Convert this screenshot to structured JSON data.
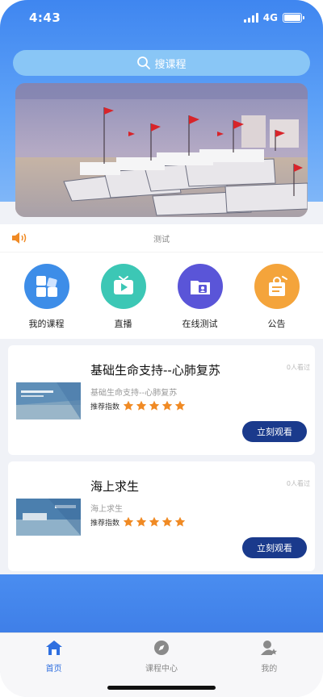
{
  "status_bar": {
    "time": "4:43",
    "network": "4G",
    "battery_level": 1.0
  },
  "search": {
    "placeholder": "搜课程"
  },
  "notice": {
    "text": "测试"
  },
  "menu": {
    "items": [
      {
        "label": "我的课程",
        "color": "#3d8de8",
        "icon": "course-icon"
      },
      {
        "label": "直播",
        "color": "#3cc7b5",
        "icon": "live-icon"
      },
      {
        "label": "在线测试",
        "color": "#5a55d8",
        "icon": "test-folder-icon"
      },
      {
        "label": "公告",
        "color": "#f4a43b",
        "icon": "announcement-icon"
      }
    ]
  },
  "courses": [
    {
      "title": "基础生命支持--心肺复苏",
      "subtitle": "基础生命支持--心肺复苏",
      "rating_label": "推荐指数",
      "rating": 5,
      "count": "0人看过",
      "button": "立刻观看"
    },
    {
      "title": "海上求生",
      "subtitle": "海上求生",
      "rating_label": "推荐指数",
      "rating": 5,
      "count": "0人看过",
      "button": "立刻观看"
    }
  ],
  "tabs": [
    {
      "label": "首页",
      "icon": "home-icon",
      "active": true
    },
    {
      "label": "课程中心",
      "icon": "compass-icon",
      "active": false
    },
    {
      "label": "我的",
      "icon": "user-star-icon",
      "active": false
    }
  ],
  "colors": {
    "primary": "#3f86f0",
    "button": "#1a3a8c",
    "star": "#f08a24"
  }
}
